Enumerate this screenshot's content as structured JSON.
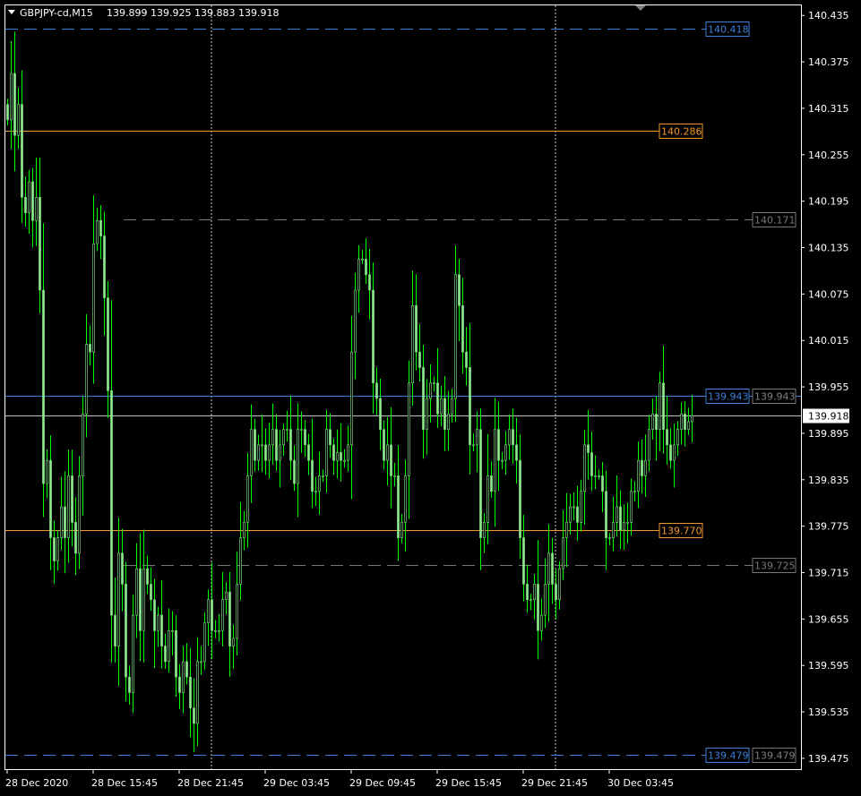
{
  "chart_data": {
    "type": "candlestick",
    "title": "GBPJPY-cd,M15",
    "ohlc_header": [
      "139.899",
      "139.925",
      "139.883",
      "139.918"
    ],
    "y_range": [
      139.461,
      140.448
    ],
    "y_ticks": [
      "140.435",
      "140.375",
      "140.315",
      "140.255",
      "140.195",
      "140.135",
      "140.075",
      "140.015",
      "139.955",
      "139.895",
      "139.835",
      "139.775",
      "139.715",
      "139.655",
      "139.595",
      "139.535",
      "139.475"
    ],
    "x_labels": [
      "28 Dec 2020",
      "28 Dec 15:45",
      "28 Dec 21:45",
      "29 Dec 03:45",
      "29 Dec 09:45",
      "29 Dec 15:45",
      "29 Dec 21:45",
      "30 Dec 03:45"
    ],
    "x_label_bars": [
      0,
      24,
      48,
      72,
      96,
      120,
      144,
      168
    ],
    "period_separator_bars": [
      57,
      153
    ],
    "current_price": "139.918",
    "levels": [
      {
        "price": "140.418",
        "style": "dash-long",
        "color": "#3d7fd9",
        "label": "140.418"
      },
      {
        "price": "140.286",
        "style": "solid",
        "color": "#f0962e",
        "label": "140.286"
      },
      {
        "price": "140.171",
        "style": "dash-long",
        "color": "#777777",
        "label": "140.171"
      },
      {
        "price": "139.943",
        "style": "solid",
        "color": "#3d7fd9",
        "label": "139.943",
        "label2": "139.943"
      },
      {
        "price": "139.770",
        "style": "solid",
        "color": "#f0962e",
        "label": "139.770"
      },
      {
        "price": "139.725",
        "style": "dash-long",
        "color": "#777777",
        "label": "139.725"
      },
      {
        "price": "139.479",
        "style": "dash-long",
        "color": "#3d7fd9",
        "label": "139.479",
        "label2": "139.479"
      }
    ],
    "closes": [
      140.3,
      140.36,
      140.28,
      140.32,
      140.2,
      140.18,
      140.22,
      140.17,
      140.2,
      140.08,
      139.83,
      139.86,
      139.76,
      139.73,
      139.76,
      139.8,
      139.76,
      139.84,
      139.78,
      139.74,
      139.84,
      139.92,
      140.01,
      140.0,
      140.14,
      140.17,
      140.15,
      140.07,
      139.95,
      139.66,
      139.62,
      139.74,
      139.7,
      139.58,
      139.56,
      139.66,
      139.72,
      139.64,
      139.72,
      139.7,
      139.68,
      139.64,
      139.66,
      139.62,
      139.6,
      139.64,
      139.64,
      139.58,
      139.56,
      139.6,
      139.58,
      139.54,
      139.52,
      139.6,
      139.6,
      139.65,
      139.68,
      139.64,
      139.64,
      139.64,
      139.68,
      139.69,
      139.62,
      139.63,
      139.7,
      139.76,
      139.78,
      139.84,
      139.9,
      139.86,
      139.88,
      139.88,
      139.86,
      139.88,
      139.9,
      139.86,
      139.88,
      139.9,
      139.9,
      139.86,
      139.83,
      139.9,
      139.9,
      139.88,
      139.86,
      139.82,
      139.82,
      139.84,
      139.84,
      139.9,
      139.88,
      139.86,
      139.87,
      139.86,
      139.86,
      139.88,
      140.0,
      140.08,
      140.12,
      140.12,
      140.1,
      140.08,
      139.96,
      139.94,
      139.9,
      139.86,
      139.88,
      139.84,
      139.84,
      139.76,
      139.78,
      139.84,
      139.96,
      140.06,
      140.0,
      139.98,
      139.9,
      139.94,
      139.96,
      139.96,
      139.92,
      139.94,
      139.9,
      139.92,
      139.94,
      140.1,
      140.06,
      140.0,
      139.98,
      139.88,
      139.88,
      139.9,
      139.76,
      139.78,
      139.84,
      139.82,
      139.9,
      139.86,
      139.86,
      139.88,
      139.9,
      139.88,
      139.86,
      139.76,
      139.7,
      139.68,
      139.68,
      139.7,
      139.64,
      139.66,
      139.7,
      139.74,
      139.7,
      139.68,
      139.72,
      139.76,
      139.78,
      139.8,
      139.8,
      139.78,
      139.82,
      139.88,
      139.87,
      139.84,
      139.84,
      139.84,
      139.82,
      139.76,
      139.76,
      139.78,
      139.8,
      139.77,
      139.78,
      139.78,
      139.82,
      139.82,
      139.86,
      139.84,
      139.86,
      139.9,
      139.92,
      139.9,
      139.96,
      139.9,
      139.88,
      139.86,
      139.88,
      139.9,
      139.92,
      139.9,
      139.91,
      139.918
    ]
  }
}
